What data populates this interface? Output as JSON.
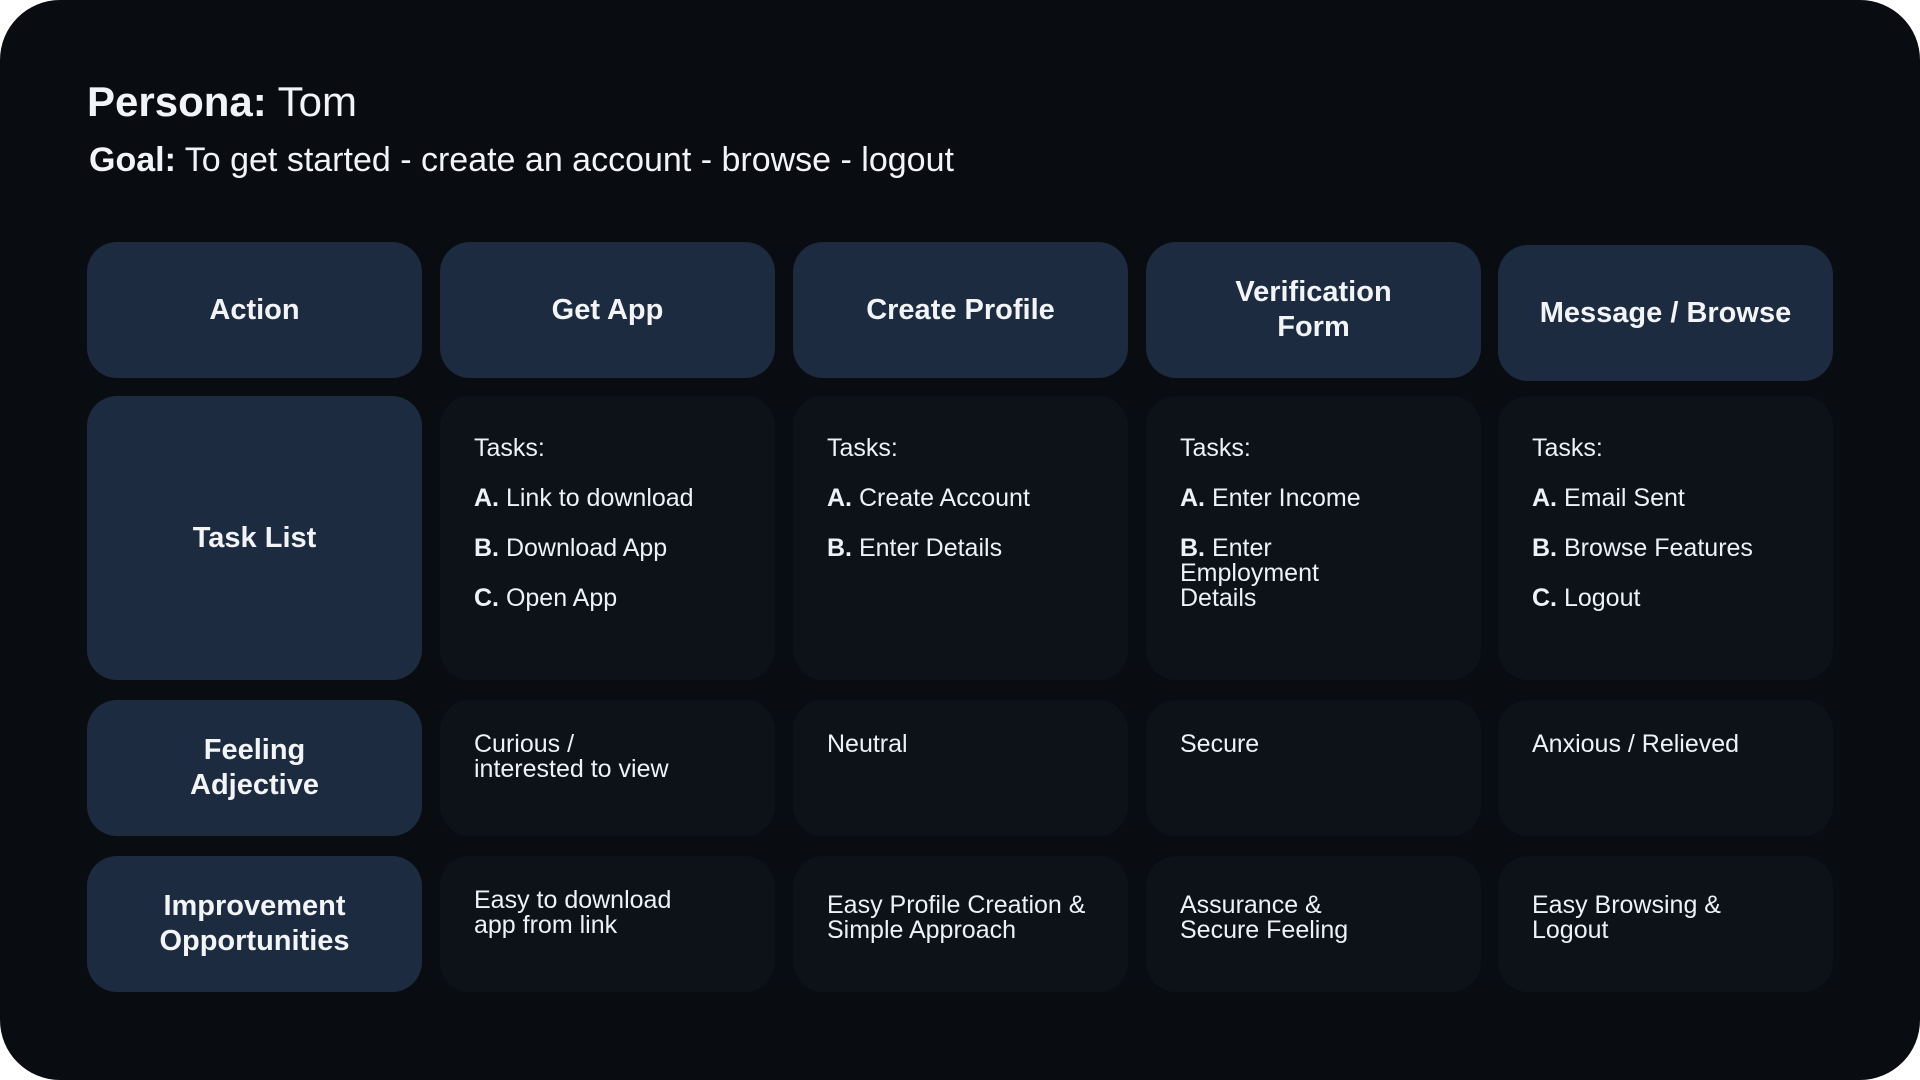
{
  "persona": {
    "label": "Persona:",
    "name": "Tom"
  },
  "goal": {
    "label": "Goal:",
    "text": "To get started - create an account - browse - logout"
  },
  "columns": [
    "Get App",
    "Create Profile",
    "Verification Form",
    "Message / Browse"
  ],
  "row_labels": {
    "action": "Action",
    "task_list": "Task List",
    "feeling": "Feeling Adjective",
    "improvement": "Improvement Opportunities"
  },
  "tasks": {
    "heading": "Tasks:",
    "get_app": [
      {
        "letter": "A.",
        "text": "Link to download"
      },
      {
        "letter": "B.",
        "text": "Download App"
      },
      {
        "letter": "C.",
        "text": "Open App"
      }
    ],
    "create_profile": [
      {
        "letter": "A.",
        "text": "Create Account"
      },
      {
        "letter": "B.",
        "text": "Enter Details"
      }
    ],
    "verification_form": [
      {
        "letter": "A.",
        "text": "Enter Income"
      },
      {
        "letter": "B.",
        "text": "Enter Employment Details"
      }
    ],
    "message_browse": [
      {
        "letter": "A.",
        "text": "Email Sent"
      },
      {
        "letter": "B.",
        "text": "Browse Features"
      },
      {
        "letter": "C.",
        "text": "Logout"
      }
    ]
  },
  "feelings": [
    "Curious / interested to view",
    "Neutral",
    "Secure",
    "Anxious / Relieved"
  ],
  "improvements": [
    "Easy to download app from link",
    "Easy Profile Creation & Simple Approach",
    "Assurance & Secure Feeling",
    "Easy Browsing & Logout"
  ],
  "colors": {
    "background": "#090c11",
    "header_cell": "#1c2b3f",
    "body_cell": "#0d1219",
    "text": "#f2f4f7"
  }
}
